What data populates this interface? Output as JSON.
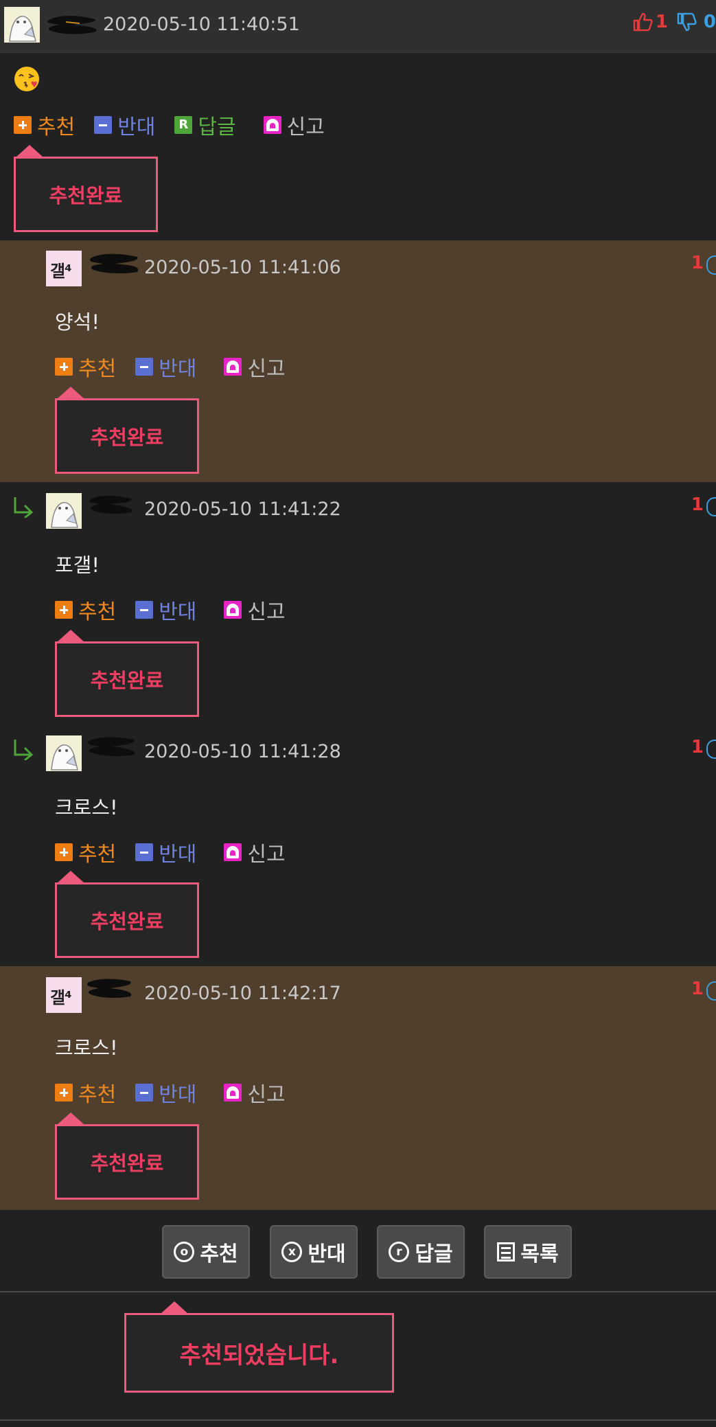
{
  "post": {
    "timestamp": "2020-05-10 11:40:51",
    "up_count": "1",
    "down_count": "0",
    "emoji": "😘",
    "actions": {
      "recommend": "추천",
      "oppose": "반대",
      "reply": "답글",
      "report": "신고"
    },
    "popup": "추천완료"
  },
  "comments": [
    {
      "timestamp": "2020-05-10 11:41:06",
      "body": "양석!",
      "count": "1",
      "avatar": "gal",
      "avatar_text": "갤⁴",
      "highlighted": true,
      "is_reply": false,
      "popup": "추천완료"
    },
    {
      "timestamp": "2020-05-10 11:41:22",
      "body": "포갤!",
      "count": "1",
      "avatar": "bear",
      "highlighted": false,
      "is_reply": true,
      "popup": "추천완료"
    },
    {
      "timestamp": "2020-05-10 11:41:28",
      "body": "크로스!",
      "count": "1",
      "avatar": "bear",
      "highlighted": false,
      "is_reply": true,
      "popup": "추천완료"
    },
    {
      "timestamp": "2020-05-10 11:42:17",
      "body": "크로스!",
      "count": "1",
      "avatar": "gal",
      "avatar_text": "갤⁴",
      "highlighted": true,
      "is_reply": false,
      "popup": "추천완료"
    }
  ],
  "comment_actions": {
    "recommend": "추천",
    "oppose": "반대",
    "report": "신고"
  },
  "bottom_bar": {
    "recommend": {
      "icon": "o",
      "label": "추천"
    },
    "oppose": {
      "icon": "x",
      "label": "반대"
    },
    "reply": {
      "icon": "r",
      "label": "답글"
    },
    "list": {
      "label": "목록"
    }
  },
  "final_popup": "추천되었습니다.",
  "colors": {
    "popup_border": "#ee5a7c",
    "popup_text": "#ee3f63",
    "highlight_bg": "#4f3f2c",
    "recommend": "#f07d12",
    "oppose": "#5a6ed4",
    "reply": "#4ea53a",
    "report": "#e824c6"
  }
}
